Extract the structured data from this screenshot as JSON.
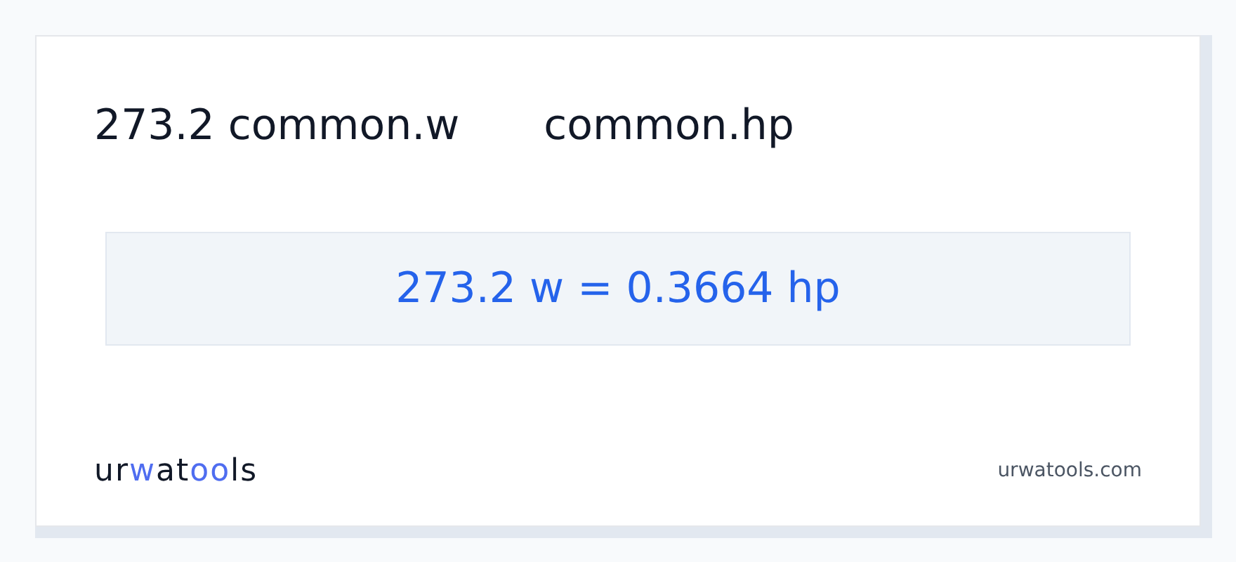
{
  "heading": {
    "from": "273.2 common.w",
    "to": "common.hp"
  },
  "result": "273.2 w = 0.3664 hp",
  "logo": [
    {
      "text": "ur",
      "accent": false
    },
    {
      "text": "w",
      "accent": true
    },
    {
      "text": "at",
      "accent": false
    },
    {
      "text": "oo",
      "accent": true
    },
    {
      "text": "ls",
      "accent": false
    }
  ],
  "site": "urwatools.com"
}
